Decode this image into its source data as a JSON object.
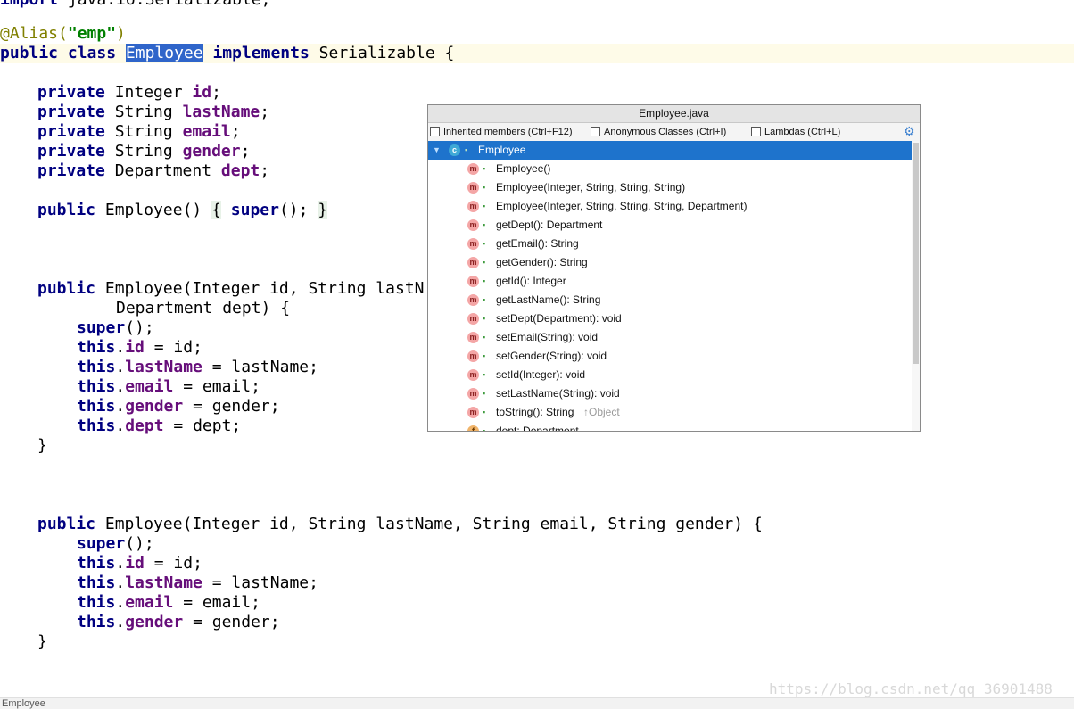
{
  "editor": {
    "lines": [
      {
        "text": "@Alias(\"emp\")"
      },
      {
        "text": "public class Employee implements Serializable {"
      },
      {
        "text": "private Integer id;"
      },
      {
        "text": "private String lastName;"
      },
      {
        "text": "private String email;"
      },
      {
        "text": "private String gender;"
      },
      {
        "text": "private Department dept;"
      },
      {
        "text": "public Employee() { super(); }"
      },
      {
        "text": "public Employee(Integer id, String lastN"
      },
      {
        "text": "Department dept) {"
      },
      {
        "text": "super();"
      },
      {
        "text": "this.id = id;"
      },
      {
        "text": "this.lastName = lastName;"
      },
      {
        "text": "this.email = email;"
      },
      {
        "text": "this.gender = gender;"
      },
      {
        "text": "this.dept = dept;"
      },
      {
        "text": "}"
      },
      {
        "text": "public Employee(Integer id, String lastName, String email, String gender) {"
      },
      {
        "text": "super();"
      },
      {
        "text": "this.id = id;"
      },
      {
        "text": "this.lastName = lastName;"
      },
      {
        "text": "this.email = email;"
      },
      {
        "text": "this.gender = gender;"
      },
      {
        "text": "}"
      }
    ]
  },
  "popup": {
    "title": "Employee.java",
    "options": {
      "inherited": "Inherited members (Ctrl+F12)",
      "anonymous": "Anonymous Classes (Ctrl+I)",
      "lambdas": "Lambdas (Ctrl+L)"
    },
    "class_name": "Employee",
    "members": [
      {
        "label": "Employee()",
        "kind": "m"
      },
      {
        "label": "Employee(Integer, String, String, String)",
        "kind": "m"
      },
      {
        "label": "Employee(Integer, String, String, String, Department)",
        "kind": "m"
      },
      {
        "label": "getDept(): Department",
        "kind": "m"
      },
      {
        "label": "getEmail(): String",
        "kind": "m"
      },
      {
        "label": "getGender(): String",
        "kind": "m"
      },
      {
        "label": "getId(): Integer",
        "kind": "m"
      },
      {
        "label": "getLastName(): String",
        "kind": "m"
      },
      {
        "label": "setDept(Department): void",
        "kind": "m"
      },
      {
        "label": "setEmail(String): void",
        "kind": "m"
      },
      {
        "label": "setGender(String): void",
        "kind": "m"
      },
      {
        "label": "setId(Integer): void",
        "kind": "m"
      },
      {
        "label": "setLastName(String): void",
        "kind": "m"
      },
      {
        "label": "toString(): String",
        "kind": "m",
        "hint": "↑Object"
      },
      {
        "label": "dept: Department",
        "kind": "f"
      }
    ]
  },
  "status": {
    "text": "Employee"
  },
  "watermark": {
    "text": "https://blog.csdn.net/qq_36901488"
  },
  "colors": {
    "selection": "#1e73cc",
    "keyword": "#000080",
    "field": "#660e7a",
    "annotation": "#808000",
    "string": "#008000"
  }
}
